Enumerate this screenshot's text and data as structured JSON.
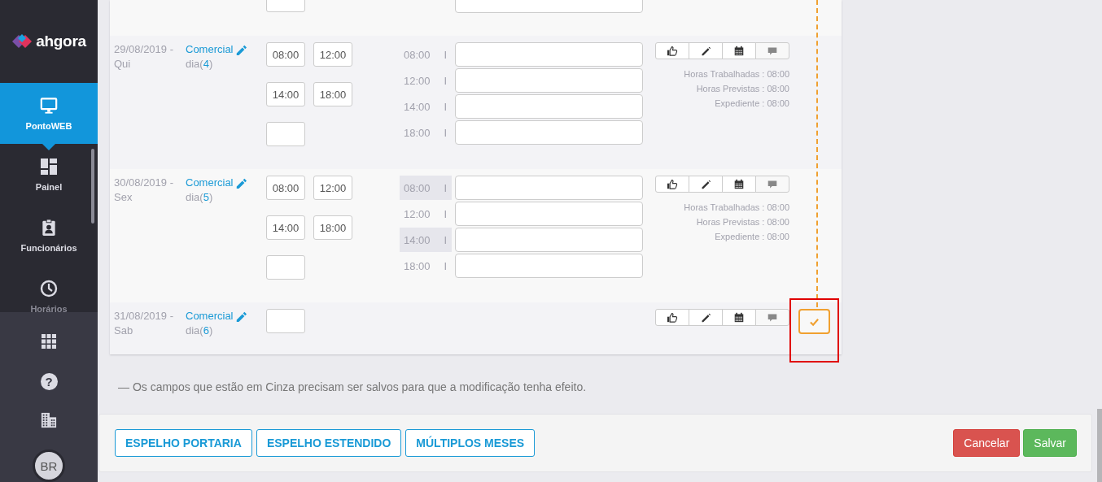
{
  "sidebar": {
    "logo": "ahgora",
    "nav": [
      {
        "label": "PontoWEB",
        "selected": true
      },
      {
        "label": "Painel",
        "selected": false
      },
      {
        "label": "Funcionários",
        "selected": false
      },
      {
        "label": "Horários",
        "selected": false
      }
    ],
    "tools": [
      {
        "kind": "apps"
      },
      {
        "kind": "help",
        "glyph": "?"
      },
      {
        "kind": "company"
      }
    ],
    "avatar": "BR"
  },
  "days": [
    {
      "date": "29/08/2019 -",
      "weekday": "Qui",
      "schedule": "Comercial",
      "day_prefix": "dia(",
      "day_number": "4",
      "day_suffix": ")",
      "times": [
        "08:00",
        "12:00",
        "14:00",
        "18:00"
      ],
      "punches": [
        {
          "time": "08:00",
          "separator": "I",
          "shaded": false
        },
        {
          "time": "12:00",
          "separator": "I",
          "shaded": false
        },
        {
          "time": "14:00",
          "separator": "I",
          "shaded": false
        },
        {
          "time": "18:00",
          "separator": "I",
          "shaded": false
        }
      ],
      "summary": [
        "Horas Trabalhadas : 08:00",
        "Horas Previstas : 08:00",
        "Expediente : 08:00"
      ],
      "check_button": false
    },
    {
      "date": "30/08/2019 -",
      "weekday": "Sex",
      "schedule": "Comercial",
      "day_prefix": "dia(",
      "day_number": "5",
      "day_suffix": ")",
      "times": [
        "08:00",
        "12:00",
        "14:00",
        "18:00"
      ],
      "punches": [
        {
          "time": "08:00",
          "separator": "I",
          "shaded": true
        },
        {
          "time": "12:00",
          "separator": "I",
          "shaded": false
        },
        {
          "time": "14:00",
          "separator": "I",
          "shaded": true
        },
        {
          "time": "18:00",
          "separator": "I",
          "shaded": false
        }
      ],
      "summary": [
        "Horas Trabalhadas : 08:00",
        "Horas Previstas : 08:00",
        "Expediente : 08:00"
      ],
      "check_button": false
    },
    {
      "date": "31/08/2019 -",
      "weekday": "Sab",
      "schedule": "Comercial",
      "day_prefix": "dia(",
      "day_number": "6",
      "day_suffix": ")",
      "check_button": true,
      "highlighted": true
    }
  ],
  "note": "— Os campos que estão em Cinza precisam ser salvos para que a modificação tenha efeito.",
  "footer": {
    "left_buttons": [
      "ESPELHO PORTARIA",
      "ESPELHO ESTENDIDO",
      "MÚLTIPLOS MESES"
    ],
    "cancel": "Cancelar",
    "save": "Salvar"
  }
}
